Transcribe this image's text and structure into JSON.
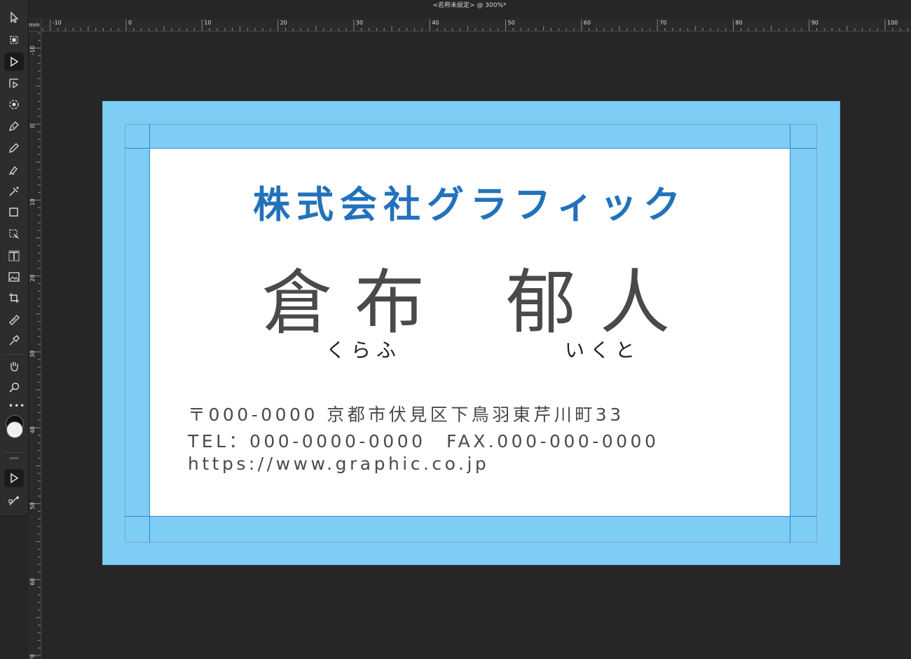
{
  "window": {
    "title": "<名称未設定> @ 300%*"
  },
  "ruler": {
    "unit": "mm",
    "h_labels": [
      "-10",
      "0",
      "10",
      "20",
      "30",
      "40",
      "50",
      "60",
      "70",
      "80",
      "90",
      "100"
    ],
    "v_labels": [
      "-10",
      "0",
      "10",
      "20",
      "30",
      "40",
      "50",
      "60",
      "70"
    ]
  },
  "tools": [
    {
      "name": "move-tool-icon"
    },
    {
      "name": "artboard-tool-icon"
    },
    {
      "name": "node-tool-icon"
    },
    {
      "name": "corner-tool-icon"
    },
    {
      "name": "point-transform-tool-icon"
    },
    {
      "name": "pen-tool-icon"
    },
    {
      "name": "pencil-tool-icon"
    },
    {
      "name": "vector-brush-tool-icon"
    },
    {
      "name": "fill-tool-icon"
    },
    {
      "name": "rectangle-tool-icon"
    },
    {
      "name": "vector-crop-tool-icon"
    },
    {
      "name": "frame-text-tool-icon"
    },
    {
      "name": "image-tool-icon"
    },
    {
      "name": "transform-tool-icon"
    },
    {
      "name": "ruler-tool-icon"
    },
    {
      "name": "color-picker-tool-icon"
    },
    {
      "name": "hand-tool-icon"
    },
    {
      "name": "zoom-tool-icon"
    }
  ],
  "card": {
    "company": "株式会社グラフィック",
    "name_chars": [
      "倉",
      "布",
      "郁",
      "人"
    ],
    "ruby_family": "くらふ",
    "ruby_given": "いくと",
    "address": "〒000-0000 京都市伏見区下鳥羽東芹川町33",
    "phone": "TEL：000-0000-0000　FAX.000-000-0000",
    "url": "https://www.graphic.co.jp"
  },
  "colors": {
    "company_text": "#2272bb",
    "bleed": "#7ecdf4",
    "guide": "#2f86d8",
    "name_text": "#4a4a4a"
  }
}
